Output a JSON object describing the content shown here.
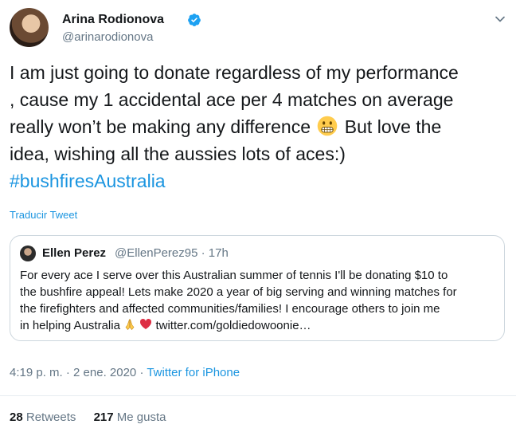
{
  "author": {
    "display_name": "Arina Rodionova",
    "handle": "@arinarodionova",
    "verified": true
  },
  "tweet": {
    "lines": [
      "I am just going to donate regardless of my performance",
      ", cause my 1 accidental ace per 4 matches on average",
      "really won’t be making any difference",
      "But love the",
      "idea, wishing all the aussies lots of aces:)"
    ],
    "hashtag": "#bushfiresAustralia",
    "emoji": "grimacing-face"
  },
  "translate_label": "Traducir Tweet",
  "quoted": {
    "display_name": "Ellen Perez",
    "handle_time": "@EllenPerez95 · 17h",
    "lines": [
      "For every ace I serve over this Australian summer of tennis I'll be donating $10 to",
      "the bushfire appeal! Lets make 2020 a year of big serving and winning matches for",
      "the firefighters and affected communities/families! I encourage others to join me",
      "in helping Australia",
      "twitter.com/goldiedowoonie…"
    ],
    "emojis": [
      "folded-hands",
      "red-heart"
    ]
  },
  "meta": {
    "timestamp": "4:19 p. m. · 2 ene. 2020 · ",
    "source": "Twitter for iPhone"
  },
  "stats": {
    "retweets_count": "28",
    "retweets_label": "Retweets",
    "likes_count": "217",
    "likes_label": "Me gusta"
  },
  "colors": {
    "link": "#1b95e0",
    "secondary": "#657786",
    "primary_text": "#14171a",
    "border": "#ccd6dd"
  }
}
